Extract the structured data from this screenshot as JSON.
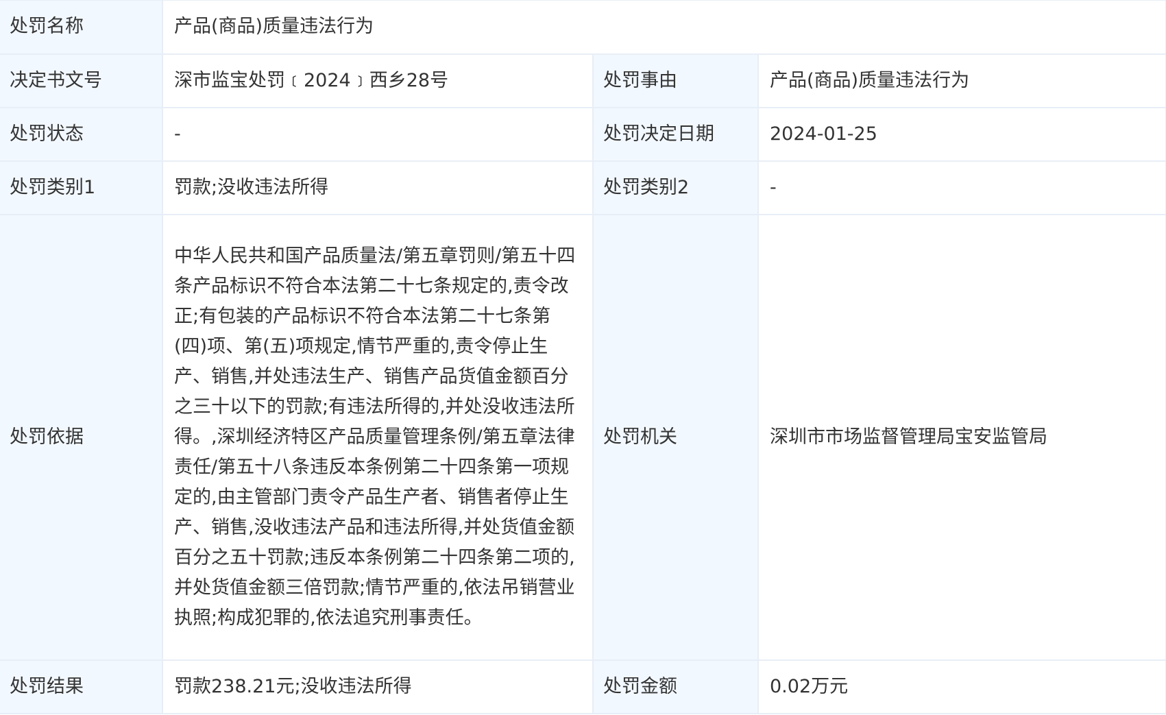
{
  "rows": {
    "penalty_name": {
      "label": "处罚名称",
      "value": "产品(商品)质量违法行为"
    },
    "decision_no": {
      "label": "决定书文号",
      "value": "深市监宝处罚﹝2024﹞西乡28号"
    },
    "penalty_reason": {
      "label": "处罚事由",
      "value": "产品(商品)质量违法行为"
    },
    "penalty_status": {
      "label": "处罚状态",
      "value": "-"
    },
    "decision_date": {
      "label": "处罚决定日期",
      "value": "2024-01-25"
    },
    "category1": {
      "label": "处罚类别1",
      "value": "罚款;没收违法所得"
    },
    "category2": {
      "label": "处罚类别2",
      "value": "-"
    },
    "basis": {
      "label": "处罚依据",
      "value": "中华人民共和国产品质量法/第五章罚则/第五十四条产品标识不符合本法第二十七条规定的,责令改正;有包装的产品标识不符合本法第二十七条第(四)项、第(五)项规定,情节严重的,责令停止生产、销售,并处违法生产、销售产品货值金额百分之三十以下的罚款;有违法所得的,并处没收违法所得。,深圳经济特区产品质量管理条例/第五章法律责任/第五十八条违反本条例第二十四条第一项规定的,由主管部门责令产品生产者、销售者停止生产、销售,没收违法产品和违法所得,并处货值金额百分之五十罚款;违反本条例第二十四条第二项的,并处货值金额三倍罚款;情节严重的,依法吊销营业执照;构成犯罪的,依法追究刑事责任。"
    },
    "authority": {
      "label": "处罚机关",
      "value": "深圳市市场监督管理局宝安监管局"
    },
    "result": {
      "label": "处罚结果",
      "value": "罚款238.21元;没收违法所得"
    },
    "amount": {
      "label": "处罚金额",
      "value": "0.02万元"
    }
  },
  "colors": {
    "label_bg": "#f2f8ff",
    "value_bg": "#ffffff",
    "border": "#e8eef6",
    "text": "#333333"
  }
}
